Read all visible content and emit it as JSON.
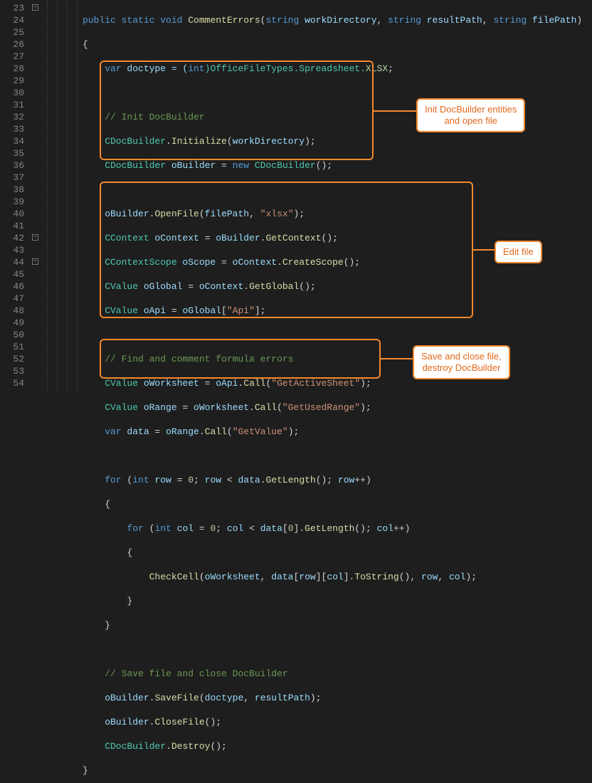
{
  "gutter": {
    "start": 23,
    "end": 54
  },
  "fold_marks": [
    {
      "line": 23,
      "glyph": "−"
    },
    {
      "line": 42,
      "glyph": "−"
    },
    {
      "line": 44,
      "glyph": "−"
    }
  ],
  "annotations": {
    "a1": "Init DocBuilder entities\nand open file",
    "a2": "Edit file",
    "a3": "Save and close file,\ndestroy DocBuilder"
  },
  "code": {
    "l23": {
      "t1": "public static void",
      "t2": " CommentErrors",
      "t3": "(",
      "t4": "string",
      "t5": " workDirectory",
      "t6": ", ",
      "t7": "string",
      "t8": " resultPath",
      "t9": ", ",
      "t10": "string",
      "t11": " filePath",
      "t12": ")"
    },
    "l24": {
      "t": "{"
    },
    "l25": {
      "t1": "    var",
      "t2": " doctype = (",
      "t3": "int",
      "t4": ")OfficeFileTypes.Spreadsheet.",
      "t5": "XLSX",
      "t6": ";"
    },
    "l27": {
      "t": "    // Init DocBuilder"
    },
    "l28": {
      "t1": "    CDocBuilder",
      "t2": ".",
      "t3": "Initialize",
      "t4": "(",
      "t5": "workDirectory",
      "t6": ");"
    },
    "l29": {
      "t1": "    CDocBuilder",
      "t2": " oBuilder",
      "t3": " = ",
      "t4": "new",
      "t5": " CDocBuilder",
      "t6": "();"
    },
    "l31": {
      "t1": "    oBuilder",
      "t2": ".",
      "t3": "OpenFile",
      "t4": "(",
      "t5": "filePath",
      "t6": ", ",
      "t7": "\"xlsx\"",
      "t8": ");"
    },
    "l32": {
      "t1": "    CContext",
      "t2": " oContext",
      "t3": " = ",
      "t4": "oBuilder",
      "t5": ".",
      "t6": "GetContext",
      "t7": "();"
    },
    "l33": {
      "t1": "    CContextScope",
      "t2": " oScope",
      "t3": " = ",
      "t4": "oContext",
      "t5": ".",
      "t6": "CreateScope",
      "t7": "();"
    },
    "l34": {
      "t1": "    CValue",
      "t2": " oGlobal",
      "t3": " = ",
      "t4": "oContext",
      "t5": ".",
      "t6": "GetGlobal",
      "t7": "();"
    },
    "l35": {
      "t1": "    CValue",
      "t2": " oApi",
      "t3": " = ",
      "t4": "oGlobal",
      "t5": "[",
      "t6": "\"Api\"",
      "t7": "];"
    },
    "l37": {
      "t": "    // Find and comment formula errors"
    },
    "l38": {
      "t1": "    CValue",
      "t2": " oWorksheet",
      "t3": " = ",
      "t4": "oApi",
      "t5": ".",
      "t6": "Call",
      "t7": "(",
      "t8": "\"GetActiveSheet\"",
      "t9": ");"
    },
    "l39": {
      "t1": "    CValue",
      "t2": " oRange",
      "t3": " = ",
      "t4": "oWorksheet",
      "t5": ".",
      "t6": "Call",
      "t7": "(",
      "t8": "\"GetUsedRange\"",
      "t9": ");"
    },
    "l40": {
      "t1": "    var",
      "t2": " data",
      "t3": " = ",
      "t4": "oRange",
      "t5": ".",
      "t6": "Call",
      "t7": "(",
      "t8": "\"GetValue\"",
      "t9": ");"
    },
    "l42": {
      "t1": "    for",
      "t2": " (",
      "t3": "int",
      "t4": " row",
      "t5": " = ",
      "t6": "0",
      "t7": "; ",
      "t8": "row",
      "t9": " < ",
      "t10": "data",
      "t11": ".",
      "t12": "GetLength",
      "t13": "(); ",
      "t14": "row",
      "t15": "++)"
    },
    "l43": {
      "t": "    {"
    },
    "l44": {
      "t1": "        for",
      "t2": " (",
      "t3": "int",
      "t4": " col",
      "t5": " = ",
      "t6": "0",
      "t7": "; ",
      "t8": "col",
      "t9": " < ",
      "t10": "data",
      "t11": "[",
      "t12": "0",
      "t13": "].",
      "t14": "GetLength",
      "t15": "(); ",
      "t16": "col",
      "t17": "++)"
    },
    "l45": {
      "t": "        {"
    },
    "l46": {
      "t1": "            CheckCell",
      "t2": "(",
      "t3": "oWorksheet",
      "t4": ", ",
      "t5": "data",
      "t6": "[",
      "t7": "row",
      "t8": "][",
      "t9": "col",
      "t10": "].",
      "t11": "ToString",
      "t12": "(), ",
      "t13": "row",
      "t14": ", ",
      "t15": "col",
      "t16": ");"
    },
    "l47": {
      "t": "        }"
    },
    "l48": {
      "t": "    }"
    },
    "l50": {
      "t": "    // Save file and close DocBuilder"
    },
    "l51": {
      "t1": "    oBuilder",
      "t2": ".",
      "t3": "SaveFile",
      "t4": "(",
      "t5": "doctype",
      "t6": ", ",
      "t7": "resultPath",
      "t8": ");"
    },
    "l52": {
      "t1": "    oBuilder",
      "t2": ".",
      "t3": "CloseFile",
      "t4": "();"
    },
    "l53": {
      "t1": "    CDocBuilder",
      "t2": ".",
      "t3": "Destroy",
      "t4": "();"
    },
    "l54": {
      "t": "}"
    }
  }
}
